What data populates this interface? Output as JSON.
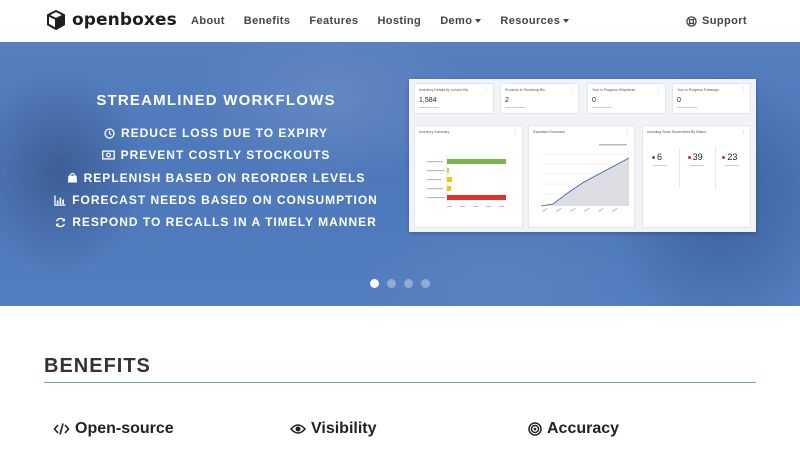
{
  "nav": {
    "brand": "openboxes",
    "links": [
      {
        "label": "About",
        "dropdown": false
      },
      {
        "label": "Benefits",
        "dropdown": false
      },
      {
        "label": "Features",
        "dropdown": false
      },
      {
        "label": "Hosting",
        "dropdown": false
      },
      {
        "label": "Demo",
        "dropdown": true
      },
      {
        "label": "Resources",
        "dropdown": true
      }
    ],
    "support": "Support"
  },
  "hero": {
    "title": "STREAMLINED WORKFLOWS",
    "items": [
      {
        "icon": "clock-icon",
        "label": "REDUCE LOSS DUE TO EXPIRY"
      },
      {
        "icon": "money-icon",
        "label": "PREVENT COSTLY STOCKOUTS"
      },
      {
        "icon": "shopping-bag-icon",
        "label": "REPLENISH BASED ON REORDER LEVELS"
      },
      {
        "icon": "bar-chart-icon",
        "label": "FORECAST NEEDS BASED ON CONSUMPTION"
      },
      {
        "icon": "refresh-icon",
        "label": "RESPOND TO RECALLS IN A TIMELY MANNER"
      }
    ],
    "dashboard": {
      "kpis": [
        {
          "title": "Inventory Details by Lot and Bin",
          "value": "1,584"
        },
        {
          "title": "Products in Receiving Bin",
          "value": "2"
        },
        {
          "title": "Your in Progress Shipments",
          "value": "0"
        },
        {
          "title": "Your in Progress Putaways",
          "value": "0"
        }
      ],
      "panels": [
        {
          "title": "Inventory Summary"
        },
        {
          "title": "Expiration Summary"
        },
        {
          "title": "Incoming Stock Movements By Status",
          "values": [
            "6",
            "39",
            "23"
          ]
        }
      ]
    },
    "carousel": {
      "count": 4,
      "active": 0
    }
  },
  "benefits": {
    "title": "BENEFITS",
    "items": [
      {
        "icon": "code-icon",
        "label": "Open-source"
      },
      {
        "icon": "eye-icon",
        "label": "Visibility"
      },
      {
        "icon": "bullseye-icon",
        "label": "Accuracy"
      }
    ]
  },
  "colors": {
    "hero_blue": "#4f7bbd",
    "rule_blue": "#7a9cc8",
    "bar_green": "#7ab648",
    "bar_yellow": "#f0c419",
    "bar_red": "#d9342b",
    "line_blue": "#3a5fa8"
  }
}
